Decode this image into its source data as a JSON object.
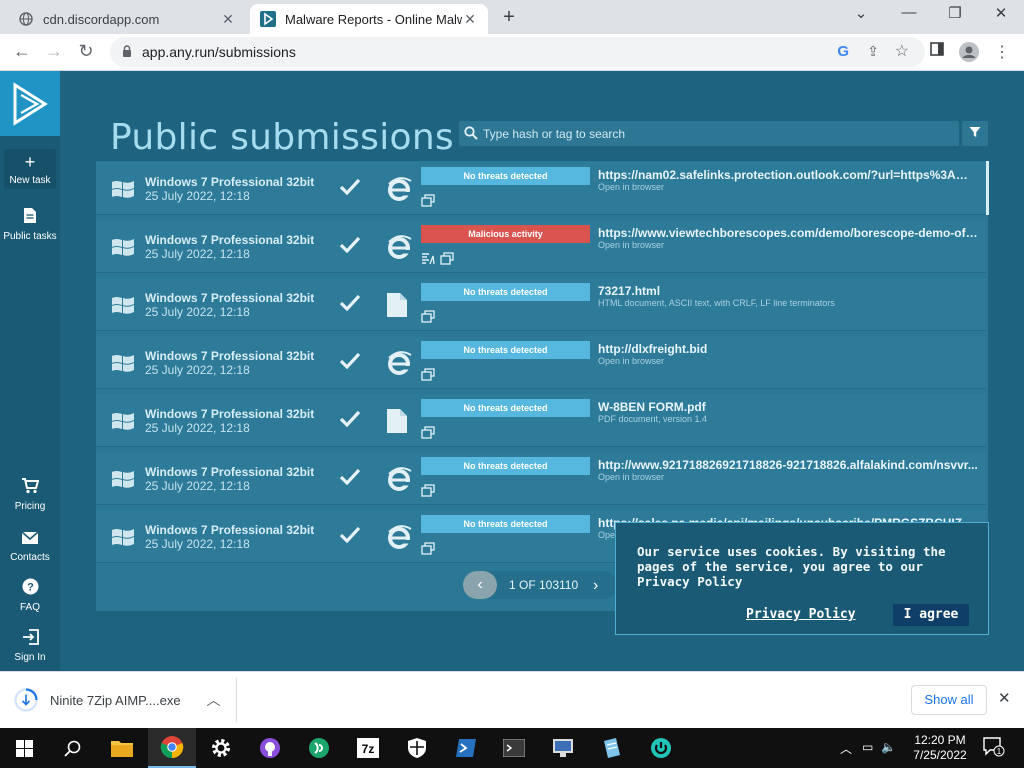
{
  "browser": {
    "tabs": [
      {
        "title": "cdn.discordapp.com",
        "active": false
      },
      {
        "title": "Malware Reports - Online Malwa",
        "active": true
      }
    ],
    "url": "app.any.run/submissions"
  },
  "sidebar": {
    "items": [
      {
        "label": "New task",
        "icon": "plus-icon"
      },
      {
        "label": "Public tasks",
        "icon": "document-icon"
      },
      {
        "label": "Pricing",
        "icon": "cart-icon"
      },
      {
        "label": "Contacts",
        "icon": "mail-icon"
      },
      {
        "label": "FAQ",
        "icon": "question-icon"
      },
      {
        "label": "Sign In",
        "icon": "sign-in-icon"
      }
    ]
  },
  "page": {
    "title": "Public submissions",
    "search_placeholder": "Type hash or tag to search"
  },
  "submissions": [
    {
      "os": "Windows 7 Professional 32bit",
      "date": "25 July 2022, 12:18",
      "app": "ie-icon",
      "verdict": "No threats detected",
      "verdict_type": "clean",
      "target": "https://nam02.safelinks.protection.outlook.com/?url=https%3A%2F...",
      "sub": "Open in browser",
      "extra_icon": false
    },
    {
      "os": "Windows 7 Professional 32bit",
      "date": "25 July 2022, 12:18",
      "app": "ie-icon",
      "verdict": "Malicious activity",
      "verdict_type": "malicious",
      "target": "https://www.viewtechborescopes.com/demo/borescope-demo-offer...",
      "sub": "Open in browser",
      "extra_icon": true
    },
    {
      "os": "Windows 7 Professional 32bit",
      "date": "25 July 2022, 12:18",
      "app": "file-icon",
      "verdict": "No threats detected",
      "verdict_type": "clean",
      "target": "73217.html",
      "sub": "HTML document, ASCII text, with CRLF, LF line terminators",
      "extra_icon": false
    },
    {
      "os": "Windows 7 Professional 32bit",
      "date": "25 July 2022, 12:18",
      "app": "ie-icon",
      "verdict": "No threats detected",
      "verdict_type": "clean",
      "target": "http://dlxfreight.bid",
      "sub": "Open in browser",
      "extra_icon": false
    },
    {
      "os": "Windows 7 Professional 32bit",
      "date": "25 July 2022, 12:18",
      "app": "file-icon",
      "verdict": "No threats detected",
      "verdict_type": "clean",
      "target": "W-8BEN FORM.pdf",
      "sub": "PDF document, version 1.4",
      "extra_icon": false
    },
    {
      "os": "Windows 7 Professional 32bit",
      "date": "25 July 2022, 12:18",
      "app": "ie-icon",
      "verdict": "No threats detected",
      "verdict_type": "clean",
      "target": "http://www.921718826921718826-921718826.alfalakind.com/nsvvr...",
      "sub": "Open in browser",
      "extra_icon": false
    },
    {
      "os": "Windows 7 Professional 32bit",
      "date": "25 July 2022, 12:18",
      "app": "ie-icon",
      "verdict": "No threats detected",
      "verdict_type": "clean",
      "target": "https://sales.pa.media/api/mailings/unsubscribe/PMRGSZBCHIZTE...",
      "sub": "Open in browser",
      "extra_icon": false
    }
  ],
  "pager": {
    "label": "1 OF 103110"
  },
  "cookie": {
    "message": "Our service uses cookies. By visiting the pages of the service, you agree to our Privacy Policy",
    "link": "Privacy Policy",
    "button": "I agree"
  },
  "downloads": {
    "file": "Ninite 7Zip AIMP....exe",
    "show_all": "Show all"
  },
  "taskbar": {
    "time": "12:20 PM",
    "date": "7/25/2022",
    "notifications": "1"
  },
  "colors": {
    "accent": "#2194c6",
    "clean": "#56b8de",
    "malicious": "#d9544f",
    "background": "#1e6480"
  }
}
